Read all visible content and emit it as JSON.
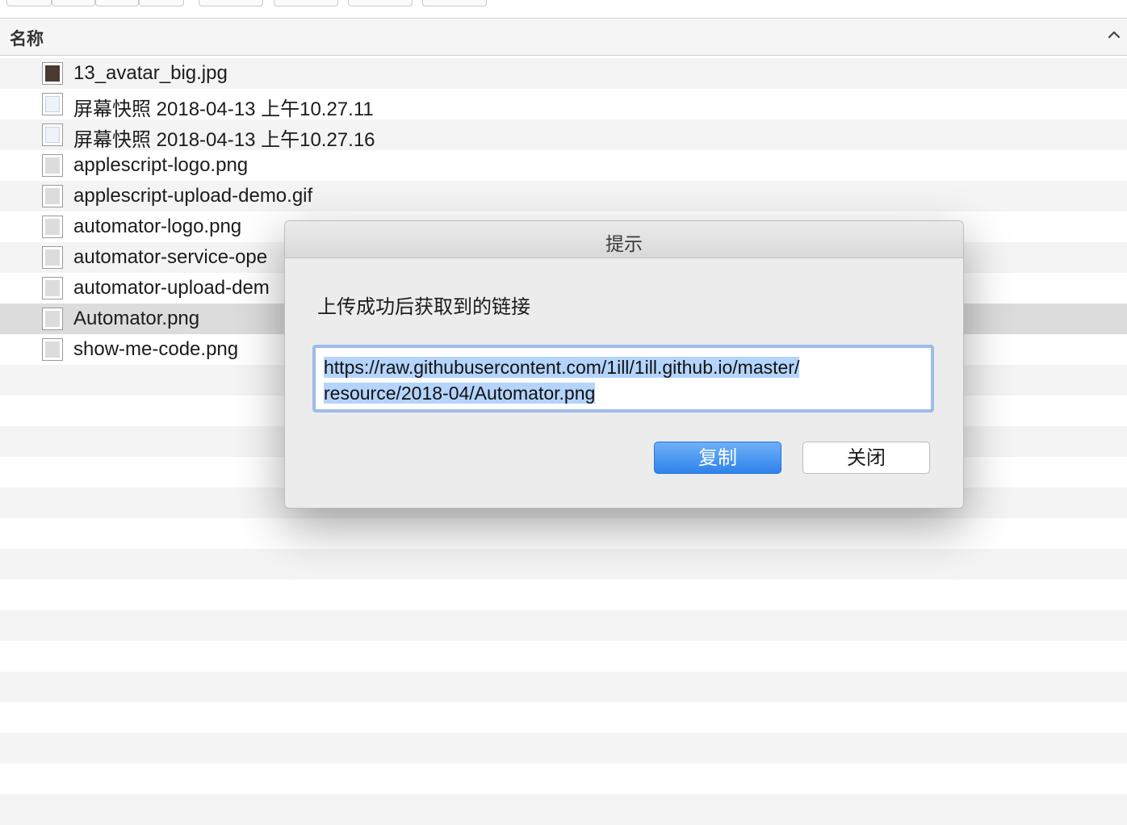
{
  "header": {
    "column_name": "名称",
    "sort_icon": "chevron-up-icon"
  },
  "files": [
    {
      "name": "13_avatar_big.jpg",
      "icon": "photo-thumbnail-icon",
      "selected": false
    },
    {
      "name": "屏幕快照 2018-04-13 上午10.27.11",
      "icon": "screenshot-file-icon",
      "selected": false
    },
    {
      "name": "屏幕快照 2018-04-13 上午10.27.16",
      "icon": "screenshot-file-icon",
      "selected": false
    },
    {
      "name": "applescript-logo.png",
      "icon": "image-file-icon",
      "selected": false
    },
    {
      "name": "applescript-upload-demo.gif",
      "icon": "image-file-icon",
      "selected": false
    },
    {
      "name": "automator-logo.png",
      "icon": "image-file-icon",
      "selected": false
    },
    {
      "name": "automator-service-ope",
      "icon": "image-file-icon",
      "selected": false
    },
    {
      "name": "automator-upload-dem",
      "icon": "image-file-icon",
      "selected": false
    },
    {
      "name": "Automator.png",
      "icon": "image-file-icon",
      "selected": true
    },
    {
      "name": "show-me-code.png",
      "icon": "image-file-icon",
      "selected": false
    }
  ],
  "dialog": {
    "title": "提示",
    "message": "上传成功后获取到的链接",
    "url_line1": "https://raw.githubusercontent.com/1ill/1ill.github.io/master/",
    "url_line2": "resource/2018-04/Automator.png",
    "copy_label": "复制",
    "close_label": "关闭"
  },
  "colors": {
    "primary_button": "#2f83ec",
    "selection_highlight": "#b4d4fb",
    "row_selected": "#dcdcdc",
    "row_alt": "#f4f4f4"
  }
}
